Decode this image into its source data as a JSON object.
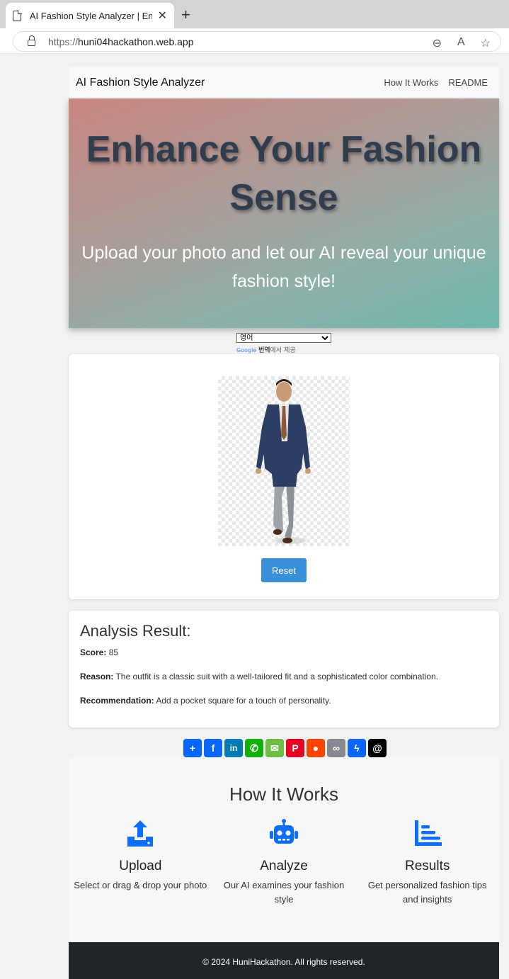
{
  "browser": {
    "tab_title": "AI Fashion Style Analyzer | Enhance Your Fashion Sense",
    "url_scheme": "https://",
    "url_host": "huni04hackathon.web.app"
  },
  "navbar": {
    "brand": "AI Fashion Style Analyzer",
    "links": [
      "How It Works",
      "README"
    ]
  },
  "hero": {
    "title": "Enhance Your Fashion Sense",
    "subtitle": "Upload your photo and let our AI reveal your unique fashion style!"
  },
  "translate": {
    "selected_language": "영어",
    "powered_google": "Google",
    "powered_translate": "번역",
    "powered_suffix": "에서 제공"
  },
  "upload": {
    "reset_label": "Reset"
  },
  "result": {
    "heading": "Analysis Result:",
    "score_label": "Score:",
    "score_value": "85",
    "reason_label": "Reason:",
    "reason_value": "The outfit is a classic suit with a well-tailored fit and a sophisticated color combination.",
    "recommendation_label": "Recommendation:",
    "recommendation_value": "Add a pocket square for a touch of personality."
  },
  "share_icons": [
    {
      "name": "addtoany-icon",
      "color": "#0166ff",
      "glyph": "+"
    },
    {
      "name": "facebook-icon",
      "color": "#0866ff",
      "glyph": "f"
    },
    {
      "name": "linkedin-icon",
      "color": "#007bb5",
      "glyph": "in"
    },
    {
      "name": "whatsapp-icon",
      "color": "#12af0a",
      "glyph": "✆"
    },
    {
      "name": "sms-icon",
      "color": "#6cbe45",
      "glyph": "✉"
    },
    {
      "name": "pinterest-icon",
      "color": "#e60023",
      "glyph": "P"
    },
    {
      "name": "reddit-icon",
      "color": "#ff4500",
      "glyph": "●"
    },
    {
      "name": "copy-link-icon",
      "color": "#888990",
      "glyph": "∞"
    },
    {
      "name": "messenger-icon",
      "color": "#0866ff",
      "glyph": "ϟ"
    },
    {
      "name": "threads-icon",
      "color": "#000000",
      "glyph": "@"
    }
  ],
  "how_it_works": {
    "heading": "How It Works",
    "steps": [
      {
        "icon": "upload-icon",
        "title": "Upload",
        "text": "Select or drag & drop your photo"
      },
      {
        "icon": "robot-icon",
        "title": "Analyze",
        "text": "Our AI examines your fashion style"
      },
      {
        "icon": "chart-icon",
        "title": "Results",
        "text": "Get personalized fashion tips and insights"
      }
    ]
  },
  "footer": {
    "text": "© 2024 HuniHackathon. All rights reserved."
  },
  "colors": {
    "accent": "#0d6efd",
    "button": "#3a8fd9",
    "hero_title": "#2f3d4e",
    "footer_bg": "#212529"
  }
}
